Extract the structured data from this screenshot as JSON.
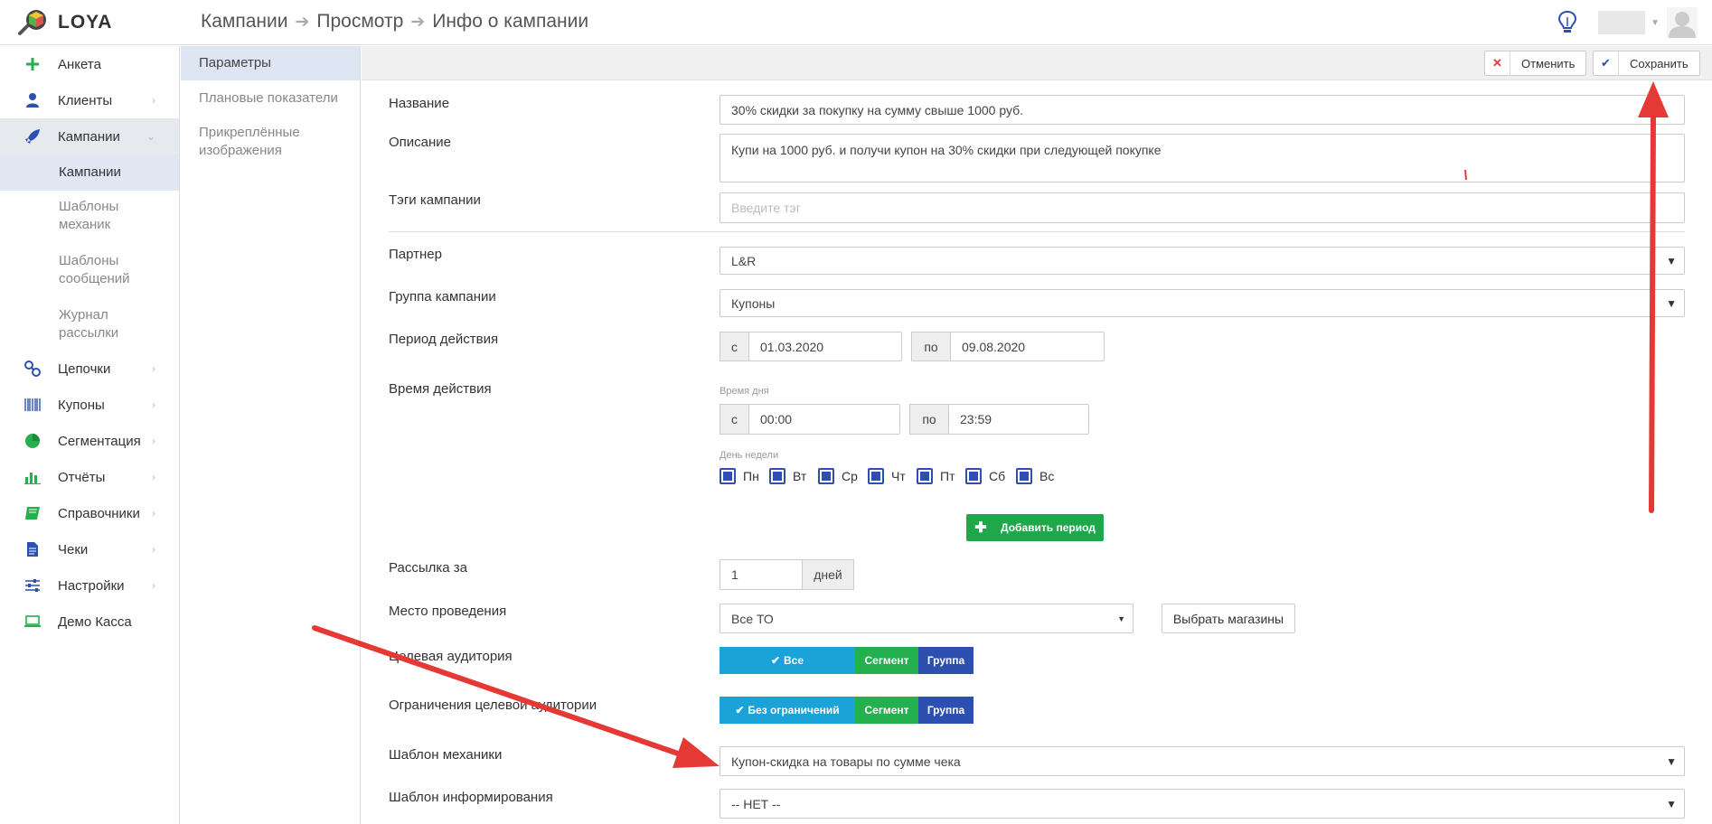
{
  "header": {
    "logo_text": "LOYA",
    "breadcrumb": [
      "Кампании",
      "Просмотр",
      "Инфо о кампании"
    ],
    "breadcrumb_sep": "➔"
  },
  "sidebar": {
    "items": [
      {
        "label": "Анкета",
        "icon": "plus-icon"
      },
      {
        "label": "Клиенты",
        "icon": "user-icon"
      },
      {
        "label": "Кампании",
        "icon": "rocket-icon"
      },
      {
        "label": "Цепочки",
        "icon": "chain-link-icon"
      },
      {
        "label": "Купоны",
        "icon": "barcode-icon"
      },
      {
        "label": "Сегментация",
        "icon": "pie-chart-icon"
      },
      {
        "label": "Отчёты",
        "icon": "bar-chart-icon"
      },
      {
        "label": "Справочники",
        "icon": "book-icon"
      },
      {
        "label": "Чеки",
        "icon": "document-icon"
      },
      {
        "label": "Настройки",
        "icon": "sliders-icon"
      },
      {
        "label": "Демо Касса",
        "icon": "laptop-icon"
      }
    ],
    "campaign_sub": [
      "Кампании",
      "Шаблоны механик",
      "Шаблоны сообщений",
      "Журнал рассылки"
    ]
  },
  "subnav": [
    "Параметры",
    "Плановые показатели",
    "Прикреплённые изображения"
  ],
  "toolbar": {
    "cancel": "Отменить",
    "save": "Сохранить"
  },
  "form": {
    "name_label": "Название",
    "name_value": "30% скидки за покупку на сумму свыше 1000 руб.",
    "desc_label": "Описание",
    "desc_value": "Купи на 1000 руб. и получи купон на 30% скидки при следующей покупке",
    "tags_label": "Тэги кампании",
    "tags_placeholder": "Введите тэг",
    "partner_label": "Партнер",
    "partner_value": "L&R",
    "group_label": "Группа кампании",
    "group_value": "Купоны",
    "period_label": "Период действия",
    "period_from_addon": "с",
    "period_from": "01.03.2020",
    "period_to_addon": "по",
    "period_to": "09.08.2020",
    "time_label": "Время действия",
    "time_of_day_label": "Время дня",
    "time_from_addon": "с",
    "time_from": "00:00",
    "time_to_addon": "по",
    "time_to": "23:59",
    "weekday_label": "День недели",
    "days": [
      "Пн",
      "Вт",
      "Ср",
      "Чт",
      "Пт",
      "Сб",
      "Вс"
    ],
    "add_period": "Добавить период",
    "mailing_label": "Рассылка за",
    "mailing_value": "1",
    "mailing_unit": "дней",
    "place_label": "Место проведения",
    "place_value": "Все ТО",
    "choose_shops": "Выбрать магазины",
    "audience_label": "Целевая аудитория",
    "audience_options": [
      "Все",
      "Сегмент",
      "Группа"
    ],
    "limits_label": "Ограничения целевой аудитории",
    "limits_options": [
      "Без ограничений",
      "Сегмент",
      "Группа"
    ],
    "mech_label": "Шаблон механики",
    "mech_value": "Купон-скидка на товары по сумме чека",
    "inform_label": "Шаблон информирования",
    "inform_value": "-- НЕТ --"
  },
  "colors": {
    "blue": "#1ba3d8",
    "green": "#25b04f",
    "navy": "#2d4fb0",
    "arrow": "#e53935"
  }
}
